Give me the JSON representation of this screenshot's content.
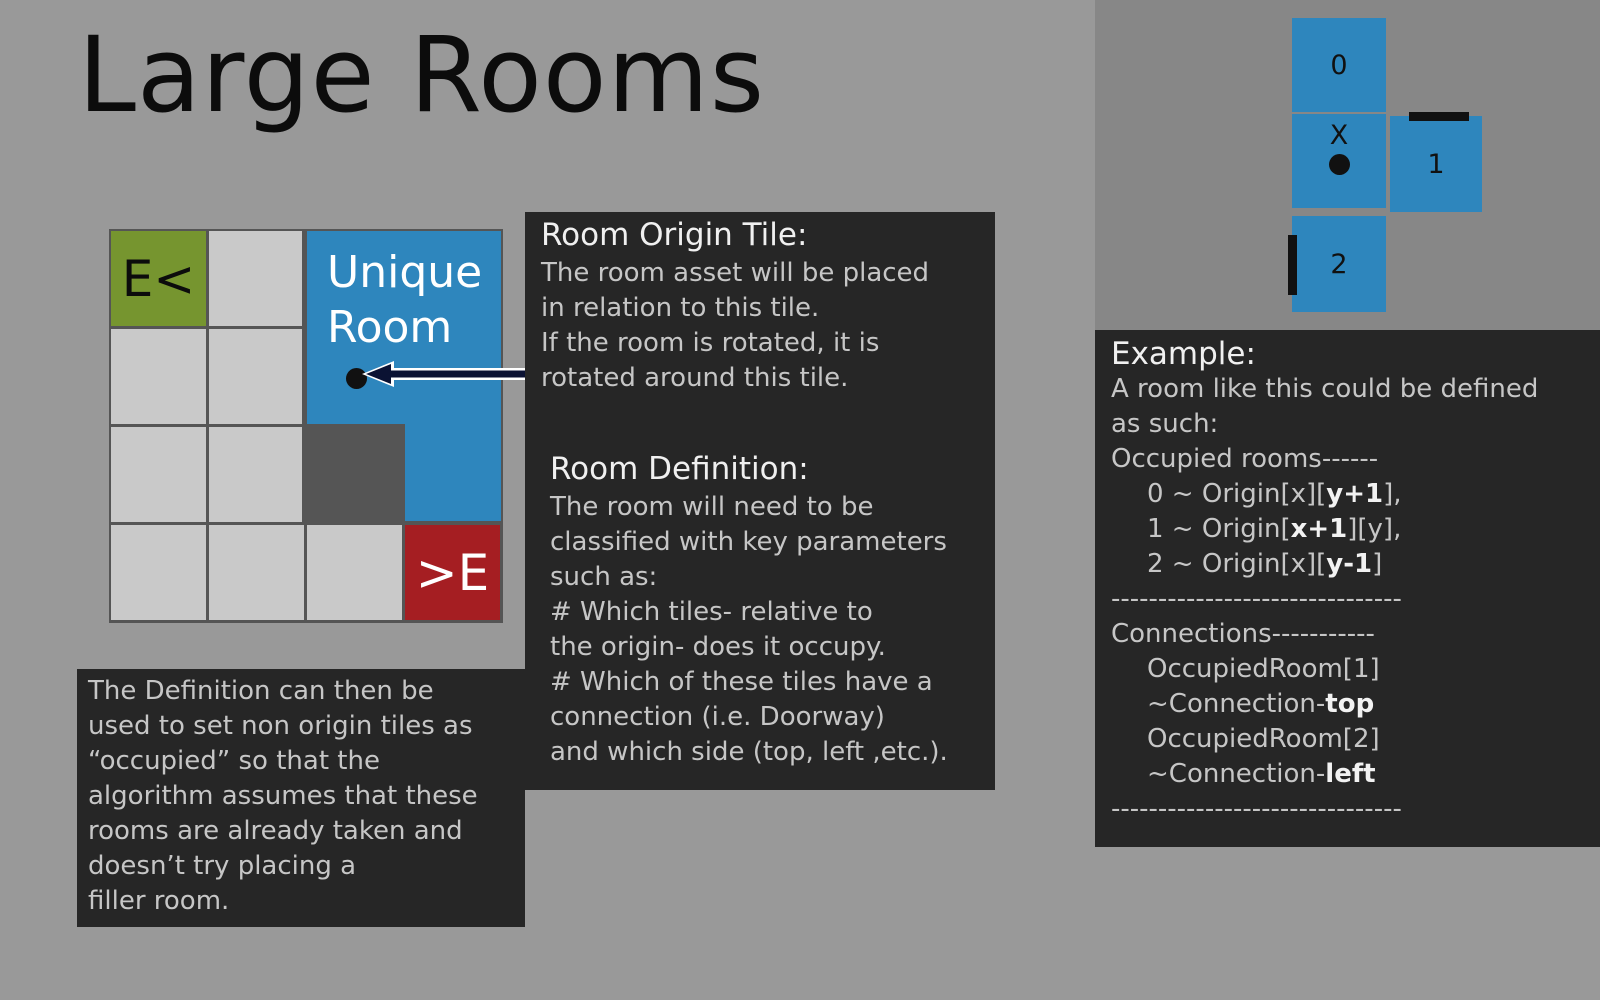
{
  "title": "Large Rooms",
  "grid": {
    "entry_label": "E<",
    "exit_label": ">E",
    "unique_room_label": "Unique\nRoom"
  },
  "origin_box": {
    "heading": "Room Origin Tile:",
    "body": "The room asset will be placed\nin relation to this tile.\nIf the room is rotated, it is\nrotated around this tile."
  },
  "definition_box": {
    "heading": "Room Definition:",
    "body": "The room will need to be\nclassified with key parameters\nsuch as:\n# Which tiles- relative to\nthe origin- does it occupy.\n# Which of these tiles have a\nconnection (i.e. Doorway)\nand which side (top, left ,etc.)."
  },
  "occupied_box": {
    "body": "The Definition can then be\nused to set non origin tiles as\n“occupied” so that the\nalgorithm assumes that these\nrooms are already taken and\ndoesn’t try placing a\nfiller room."
  },
  "mini_diagram": {
    "tile_0": "0",
    "tile_x": "X",
    "tile_1": "1",
    "tile_2": "2"
  },
  "example": {
    "heading": "Example:",
    "intro": "A room like this could be defined\nas such:",
    "occupied_header": "Occupied rooms------",
    "occ0_pre": "0 ~ Origin[x][",
    "occ0_bold": "y+1",
    "occ0_post": "],",
    "occ1_pre": "1 ~ Origin[",
    "occ1_bold": "x+1",
    "occ1_post": "][y],",
    "occ2_pre": "2 ~ Origin[x][",
    "occ2_bold": "y-1",
    "occ2_post": "]",
    "divider": "-------------------------------",
    "connections_header": "Connections-----------",
    "conn1_room": "OccupiedRoom[1]",
    "conn1_pre": "~Connection-",
    "conn1_bold": "top",
    "conn2_room": "OccupiedRoom[2]",
    "conn2_pre": "~Connection-",
    "conn2_bold": "left"
  },
  "colors": {
    "background": "#999999",
    "side_panel": "#878787",
    "dark_box": "#262626",
    "tile_blue": "#2e86bd",
    "tile_green": "#76952f",
    "tile_red": "#a51e22",
    "tile_empty": "#c9c9c9"
  }
}
